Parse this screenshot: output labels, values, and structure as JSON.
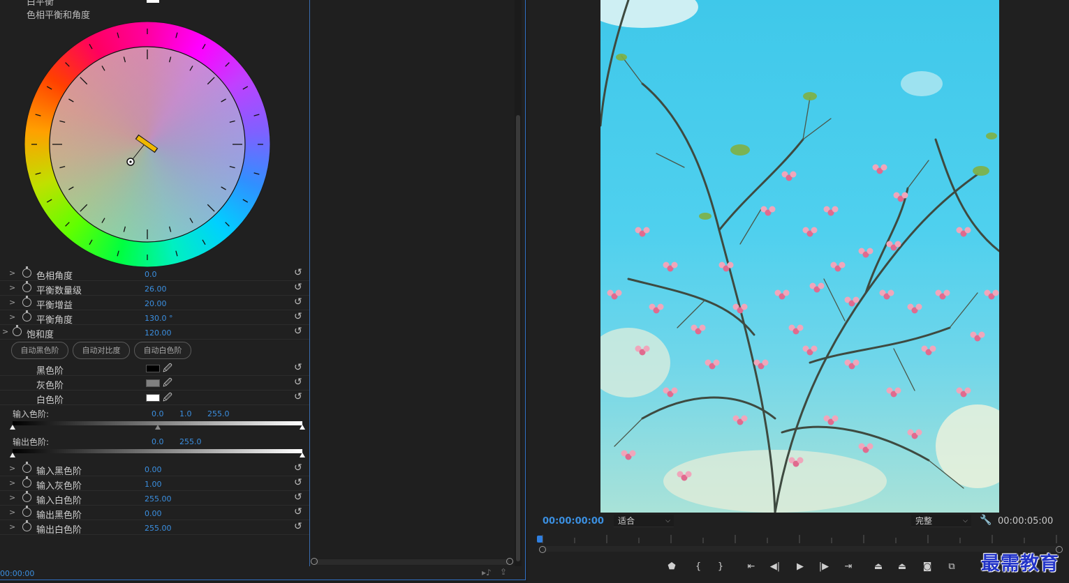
{
  "effect_controls": {
    "top_cut_label": "白平衡",
    "section_title": "色相平衡和角度",
    "rows_top": [
      {
        "label": "色相角度",
        "value": "0.0"
      },
      {
        "label": "平衡数量级",
        "value": "26.00"
      },
      {
        "label": "平衡增益",
        "value": "20.00"
      },
      {
        "label": "平衡角度",
        "value": "130.0 °"
      },
      {
        "label": "饱和度",
        "value": "120.00"
      }
    ],
    "auto_buttons": [
      "自动黑色阶",
      "自动对比度",
      "自动白色阶"
    ],
    "levels": [
      {
        "label": "黑色阶",
        "color": "#000000"
      },
      {
        "label": "灰色阶",
        "color": "#808080"
      },
      {
        "label": "白色阶",
        "color": "#ffffff"
      }
    ],
    "input_levels": {
      "label": "输入色阶:",
      "values": [
        "0.0",
        "1.0",
        "255.0"
      ]
    },
    "output_levels": {
      "label": "输出色阶:",
      "values": [
        "0.0",
        "255.0"
      ]
    },
    "rows_bottom": [
      {
        "label": "输入黑色阶",
        "value": "0.00"
      },
      {
        "label": "输入灰色阶",
        "value": "1.00"
      },
      {
        "label": "输入白色阶",
        "value": "255.00"
      },
      {
        "label": "输出黑色阶",
        "value": "0.00"
      },
      {
        "label": "输出白色阶",
        "value": "255.00"
      }
    ],
    "timecode": "00:00:00"
  },
  "monitor": {
    "timecode_current": "00:00:00:00",
    "timecode_duration": "00:00:05:00",
    "zoom_select": "适合",
    "quality_select": "完整",
    "accent": "#3b8fe0"
  },
  "watermark": "最需教育"
}
